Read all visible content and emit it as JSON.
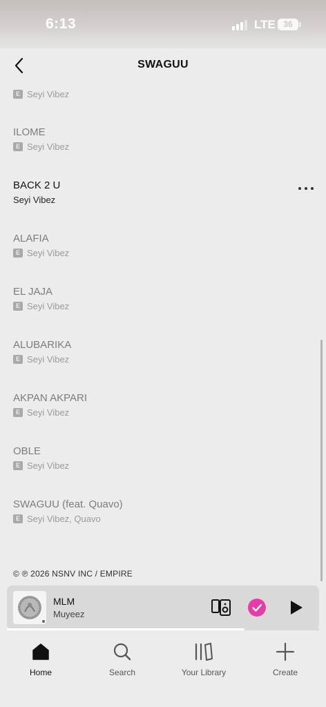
{
  "status_bar": {
    "time": "6:13",
    "network": "LTE",
    "battery": "36"
  },
  "header": {
    "title": "SWAGUU"
  },
  "partial_track": {
    "explicit": "E",
    "artist": "Seyi Vibez"
  },
  "tracks": [
    {
      "title": "ILOME",
      "explicit": "E",
      "artist": "Seyi Vibez"
    },
    {
      "title": "BACK 2 U",
      "explicit": "",
      "artist": "Seyi Vibez"
    },
    {
      "title": "ALAFIA",
      "explicit": "E",
      "artist": "Seyi Vibez"
    },
    {
      "title": "EL JAJA",
      "explicit": "E",
      "artist": "Seyi Vibez"
    },
    {
      "title": "ALUBARIKA",
      "explicit": "E",
      "artist": "Seyi Vibez"
    },
    {
      "title": "AKPAN AKPARI",
      "explicit": "E",
      "artist": "Seyi Vibez"
    },
    {
      "title": "OBLE",
      "explicit": "E",
      "artist": "Seyi Vibez"
    },
    {
      "title": "SWAGUU (feat. Quavo)",
      "explicit": "E",
      "artist": "Seyi Vibez, Quavo"
    }
  ],
  "copyright": "© ℗ 2026 NSNV INC / EMPIRE",
  "now_playing": {
    "title": "MLM",
    "artist": "Muyeez",
    "progress": 0.76
  },
  "tabs": [
    {
      "label": "Home",
      "icon": "home-icon",
      "active": true
    },
    {
      "label": "Search",
      "icon": "search-icon",
      "active": false
    },
    {
      "label": "Your Library",
      "icon": "library-icon",
      "active": false
    },
    {
      "label": "Create",
      "icon": "plus-icon",
      "active": false
    }
  ],
  "colors": {
    "accent": "#e63ca8",
    "background": "#ececec",
    "mini_player": "#d9d9d9"
  }
}
